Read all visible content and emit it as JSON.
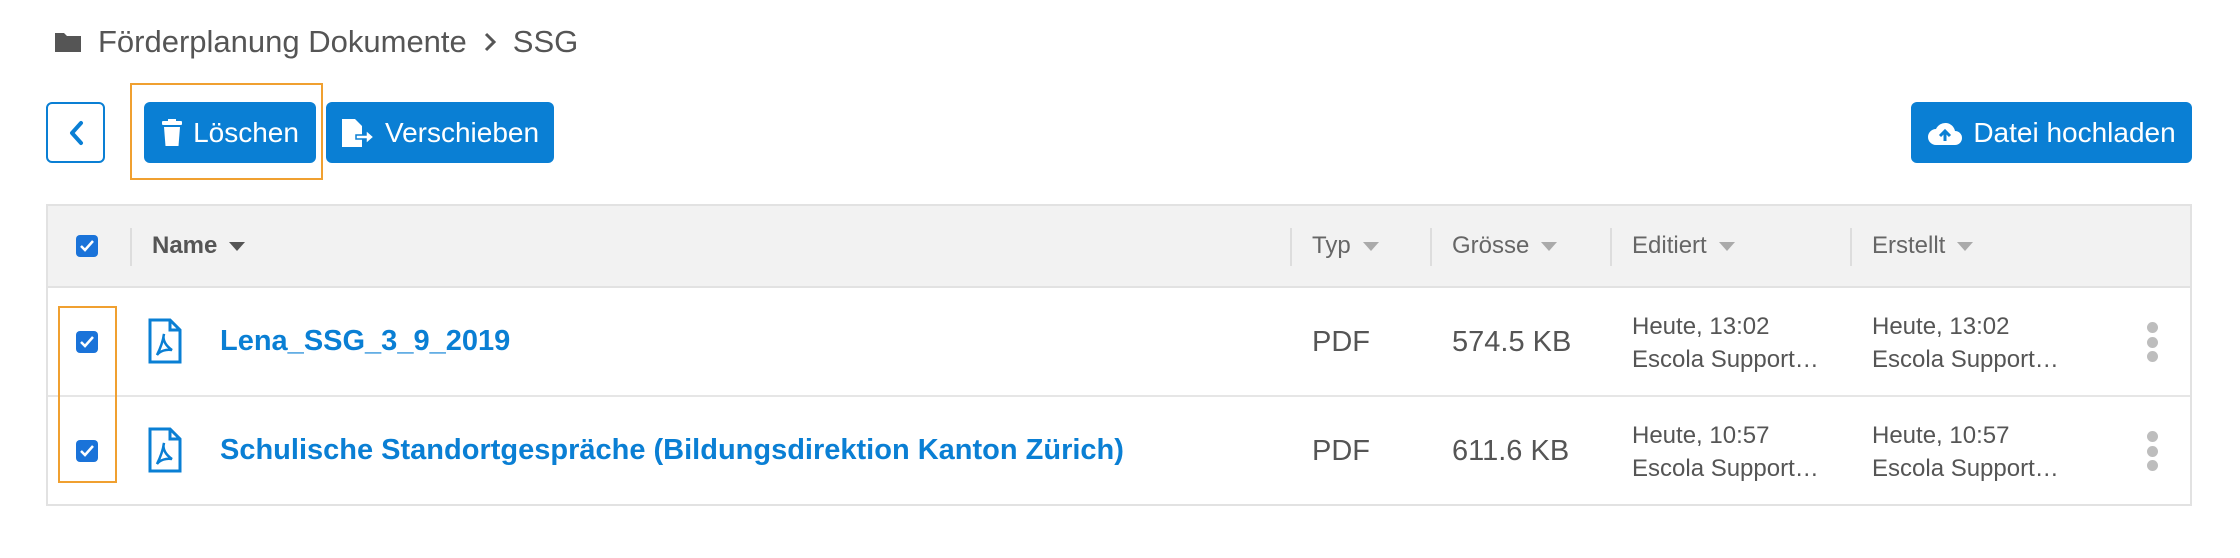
{
  "breadcrumb": {
    "folder": "Förderplanung Dokumente",
    "current": "SSG"
  },
  "toolbar": {
    "delete_label": "Löschen",
    "move_label": "Verschieben",
    "upload_label": "Datei hochladen"
  },
  "table": {
    "columns": {
      "name": "Name",
      "type": "Typ",
      "size": "Grösse",
      "edited": "Editiert",
      "created": "Erstellt"
    },
    "rows": [
      {
        "name": "Lena_SSG_3_9_2019",
        "type": "PDF",
        "size": "574.5 KB",
        "edited_time": "Heute, 13:02",
        "edited_by": "Escola Support…",
        "created_time": "Heute, 13:02",
        "created_by": "Escola Support…",
        "checked": true
      },
      {
        "name": "Schulische Standortgespräche (Bildungsdirektion Kanton Zürich)",
        "type": "PDF",
        "size": "611.6 KB",
        "edited_time": "Heute, 10:57",
        "edited_by": "Escola Support…",
        "created_time": "Heute, 10:57",
        "created_by": "Escola Support…",
        "checked": true
      }
    ]
  },
  "colors": {
    "primary": "#0a7fd4",
    "highlight": "#f0a030",
    "checkbox": "#1a73d9"
  },
  "icons": [
    "folder-icon",
    "chevron-right-icon",
    "chevron-left-icon",
    "trash-icon",
    "file-move-icon",
    "cloud-upload-icon",
    "pdf-file-icon",
    "kebab-menu-icon"
  ]
}
